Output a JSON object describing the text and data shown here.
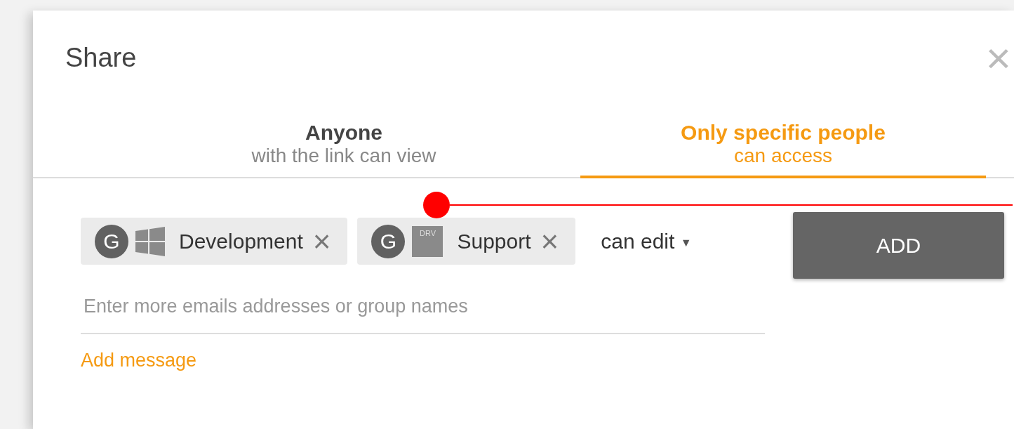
{
  "dialog": {
    "title": "Share",
    "close": "×"
  },
  "tabs": [
    {
      "label": "Anyone",
      "sublabel": "with the link can view",
      "selected": false
    },
    {
      "label": "Only specific people",
      "sublabel": "can access",
      "selected": true
    }
  ],
  "recipients": [
    {
      "avatar": "G",
      "kind": "windows",
      "name": "Development",
      "remove": "×"
    },
    {
      "avatar": "G",
      "kind": "badge",
      "badge": "DRV",
      "name": "Support",
      "remove": "×"
    }
  ],
  "permission": {
    "value": "can edit",
    "caret": "▼"
  },
  "add_button": "ADD",
  "email_field": {
    "placeholder": "Enter more emails addresses or group names"
  },
  "add_message": "Add message"
}
